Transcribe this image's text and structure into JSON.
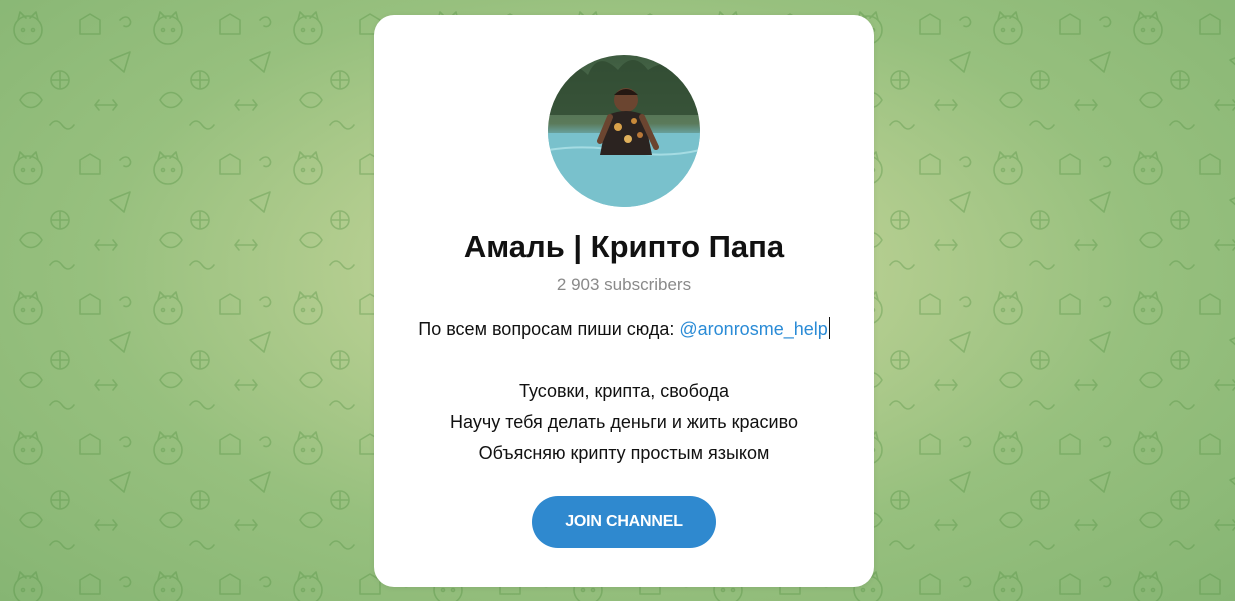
{
  "channel": {
    "title": "Амаль | Крипто Папа",
    "subscribers": "2 903 subscribers",
    "description": {
      "prefix": "По всем вопросам пиши сюда: ",
      "link": "@aronrosme_help",
      "lines": [
        "Тусовки, крипта, свобода",
        "Научу тебя делать деньги и жить красиво",
        "Объясняю крипту простым языком"
      ]
    }
  },
  "actions": {
    "join_label": "JOIN CHANNEL"
  },
  "colors": {
    "accent": "#2f89cf",
    "link": "#2a8bd6",
    "background": "#b3cd8f"
  },
  "icons": {
    "background": "doodle-pattern"
  }
}
